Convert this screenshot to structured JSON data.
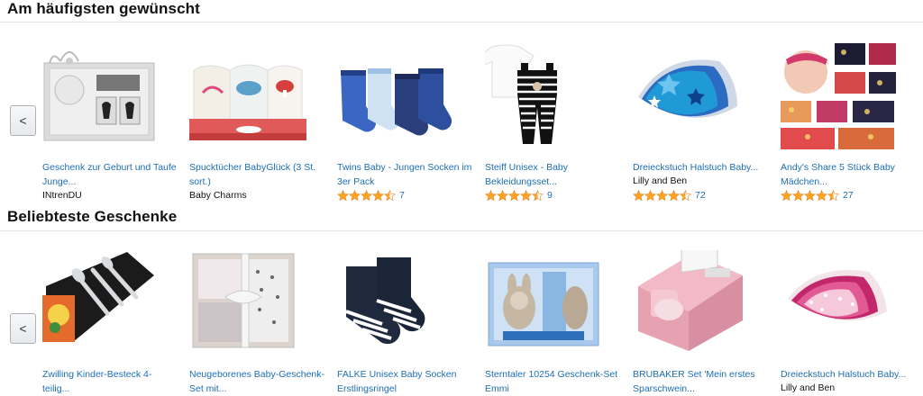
{
  "sections": [
    {
      "title": "Am häufigsten gewünscht",
      "prev_label": "<",
      "items": [
        {
          "title": "Geschenk zur Geburt und Taufe Junge...",
          "brand": "INtrenDU",
          "rating_count": ""
        },
        {
          "title": "Spucktücher BabyGlück (3 St. sort.)",
          "brand": "Baby Charms",
          "rating_count": ""
        },
        {
          "title": "Twins Baby - Jungen Socken im 3er Pack",
          "brand": "",
          "rating_count": "7",
          "stars": 4.5
        },
        {
          "title": "Steiff Unisex - Baby Bekleidungsset...",
          "brand": "",
          "rating_count": "9",
          "stars": 4.5
        },
        {
          "title": "Dreieckstuch Halstuch Baby...",
          "brand": "Lilly and Ben",
          "rating_count": "72",
          "stars": 4.5
        },
        {
          "title": "Andy's Share 5 Stück Baby Mädchen...",
          "brand": "",
          "rating_count": "27",
          "stars": 4.5
        }
      ]
    },
    {
      "title": "Beliebteste Geschenke",
      "prev_label": "<",
      "items": [
        {
          "title": "Zwilling Kinder-Besteck 4-teilig...",
          "brand": "",
          "rating_count": ""
        },
        {
          "title": "Neugeborenes Baby-Geschenk- Set mit...",
          "brand": "",
          "rating_count": ""
        },
        {
          "title": "FALKE Unisex Baby Socken Erstlingsringel",
          "brand": "",
          "rating_count": ""
        },
        {
          "title": "Sterntaler 10254 Geschenk-Set Emmi",
          "brand": "",
          "rating_count": ""
        },
        {
          "title": "BRUBAKER Set 'Mein erstes Sparschwein...",
          "brand": "",
          "rating_count": ""
        },
        {
          "title": "Dreieckstuch Halstuch Baby...",
          "brand": "Lilly and Ben",
          "rating_count": ""
        }
      ]
    }
  ],
  "colors": {
    "link": "#1d6eb4",
    "star": "#ffa41c",
    "divider": "#e3e6e6"
  },
  "icons": {
    "prev": "chevron-left-icon",
    "star": "star-icon"
  }
}
